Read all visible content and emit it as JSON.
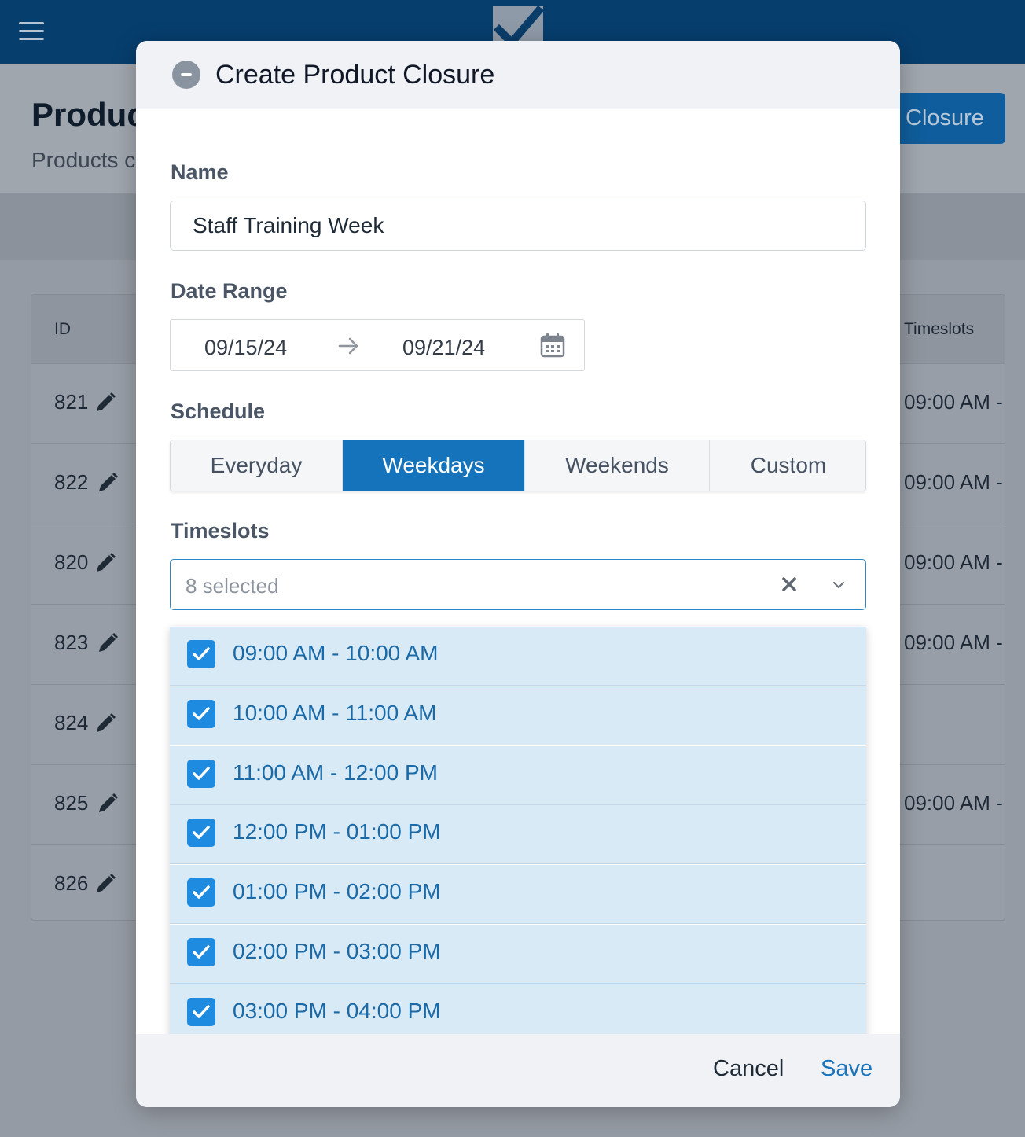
{
  "background": {
    "page_title": "Produc",
    "page_subtitle": "Products c",
    "header_button": "Closure",
    "table": {
      "col_id": "ID",
      "col_timeslots": "Timeslots",
      "rows": [
        {
          "id": "821",
          "timeslot": "09:00 AM -"
        },
        {
          "id": "822",
          "timeslot": "09:00 AM -"
        },
        {
          "id": "820",
          "timeslot": "09:00 AM -"
        },
        {
          "id": "823",
          "timeslot": "09:00 AM -"
        },
        {
          "id": "824",
          "timeslot": ""
        },
        {
          "id": "825",
          "timeslot": "09:00 AM -"
        },
        {
          "id": "826",
          "timeslot": ""
        }
      ]
    }
  },
  "modal": {
    "title": "Create Product Closure",
    "name_label": "Name",
    "name_value": "Staff Training Week",
    "date_range_label": "Date Range",
    "date_start": "09/15/24",
    "date_end": "09/21/24",
    "schedule_label": "Schedule",
    "schedule_options": [
      "Everyday",
      "Weekdays",
      "Weekends",
      "Custom"
    ],
    "schedule_selected": "Weekdays",
    "timeslots_label": "Timeslots",
    "timeslots_summary": "8 selected",
    "timeslot_options": [
      {
        "label": "09:00 AM - 10:00 AM",
        "checked": true
      },
      {
        "label": "10:00 AM - 11:00 AM",
        "checked": true
      },
      {
        "label": "11:00 AM - 12:00 PM",
        "checked": true
      },
      {
        "label": "12:00 PM - 01:00 PM",
        "checked": true
      },
      {
        "label": "01:00 PM - 02:00 PM",
        "checked": true
      },
      {
        "label": "02:00 PM - 03:00 PM",
        "checked": true
      },
      {
        "label": "03:00 PM - 04:00 PM",
        "checked": true
      }
    ],
    "cancel_label": "Cancel",
    "save_label": "Save"
  },
  "colors": {
    "topbar": "#063e6e",
    "accent": "#1473ba",
    "checkbox": "#1f8be0",
    "option_bg": "#d9eaf7"
  },
  "icons": [
    "menu-icon",
    "logo-check-icon",
    "minus-circle-icon",
    "arrow-right-icon",
    "calendar-icon",
    "clear-x-icon",
    "chevron-down-icon",
    "checkbox-checked-icon",
    "pencil-icon"
  ]
}
